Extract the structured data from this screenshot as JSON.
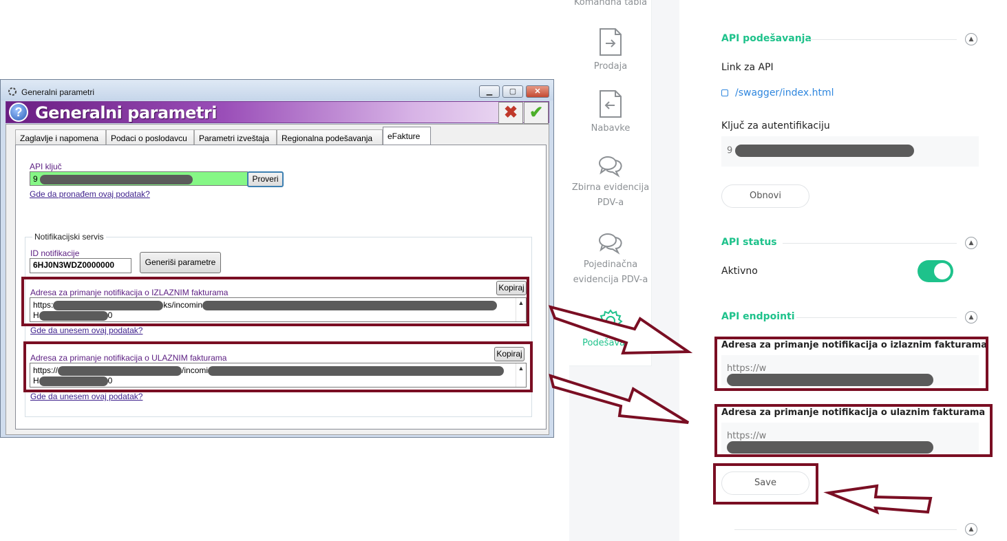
{
  "sidebar": {
    "top_label": "Komandna tabla",
    "items": [
      {
        "label": "Prodaja",
        "icon": "document-arrow-right-icon"
      },
      {
        "label": "Nabavke",
        "icon": "document-arrow-left-icon"
      },
      {
        "label_line1": "Zbirna evidencija",
        "label_line2": "PDV-a",
        "icon": "chat-bubbles-icon"
      },
      {
        "label_line1": "Pojedinačna",
        "label_line2": "evidencija PDV-a",
        "icon": "chat-bubbles-icon"
      },
      {
        "label": "Podešavanja",
        "icon": "gear-icon",
        "active": true
      }
    ]
  },
  "panel": {
    "api_settings": {
      "title": "API podešavanja",
      "link_label": "Link za API",
      "link_text": "/swagger/index.html",
      "key_label": "Ključ za autentifikaciju",
      "key_prefix": "9",
      "refresh_button": "Obnovi"
    },
    "api_status": {
      "title": "API status",
      "active_label": "Aktivno",
      "active": true
    },
    "api_endpoints": {
      "title": "API endpointi",
      "outgoing_label": "Adresa za primanje notifikacija o izlaznim fakturama",
      "outgoing_prefix": "https://w",
      "incoming_label": "Adresa za primanje notifikacija o ulaznim fakturama",
      "incoming_prefix": "https://w",
      "save_button": "Save"
    },
    "accent_color": "#1ec28b",
    "highlight_color": "#7a0e23"
  },
  "dialog": {
    "window_title": "Generalni parametri",
    "banner_title": "Generalni parametri",
    "tabs": [
      "Zaglavlje i napomena",
      "Podaci o poslodavcu",
      "Parametri izveštaja",
      "Regionalna podešavanja",
      "eFakture"
    ],
    "active_tab": "eFakture",
    "api_key_label": "API ključ",
    "api_key_prefix": "9",
    "check_button": "Proveri",
    "where_find_link": "Gde da pronađem ovaj podatak?",
    "notif_group_title": "Notifikacijski servis",
    "notif_id_label": "ID notifikacije",
    "notif_id_value": "6HJ0N3WDZ0000000",
    "generate_button": "Generiši parametre",
    "outgoing_label": "Adresa za primanje notifikacija o IZLAZNIM fakturama",
    "outgoing_line1_prefix": "https:",
    "outgoing_line1_mid": "ks/incomin",
    "outgoing_line2_prefix": "H",
    "outgoing_line2_suffix": "0",
    "incoming_label": "Adresa za primanje notifikacija o ULAZNIM fakturama",
    "incoming_line1_prefix": "https://",
    "incoming_line1_mid": "/incomi",
    "incoming_line2_prefix": "H",
    "incoming_line2_suffix": "0",
    "copy_button": "Kopiraj",
    "where_enter_link": "Gde da unesem ovaj podatak?"
  }
}
